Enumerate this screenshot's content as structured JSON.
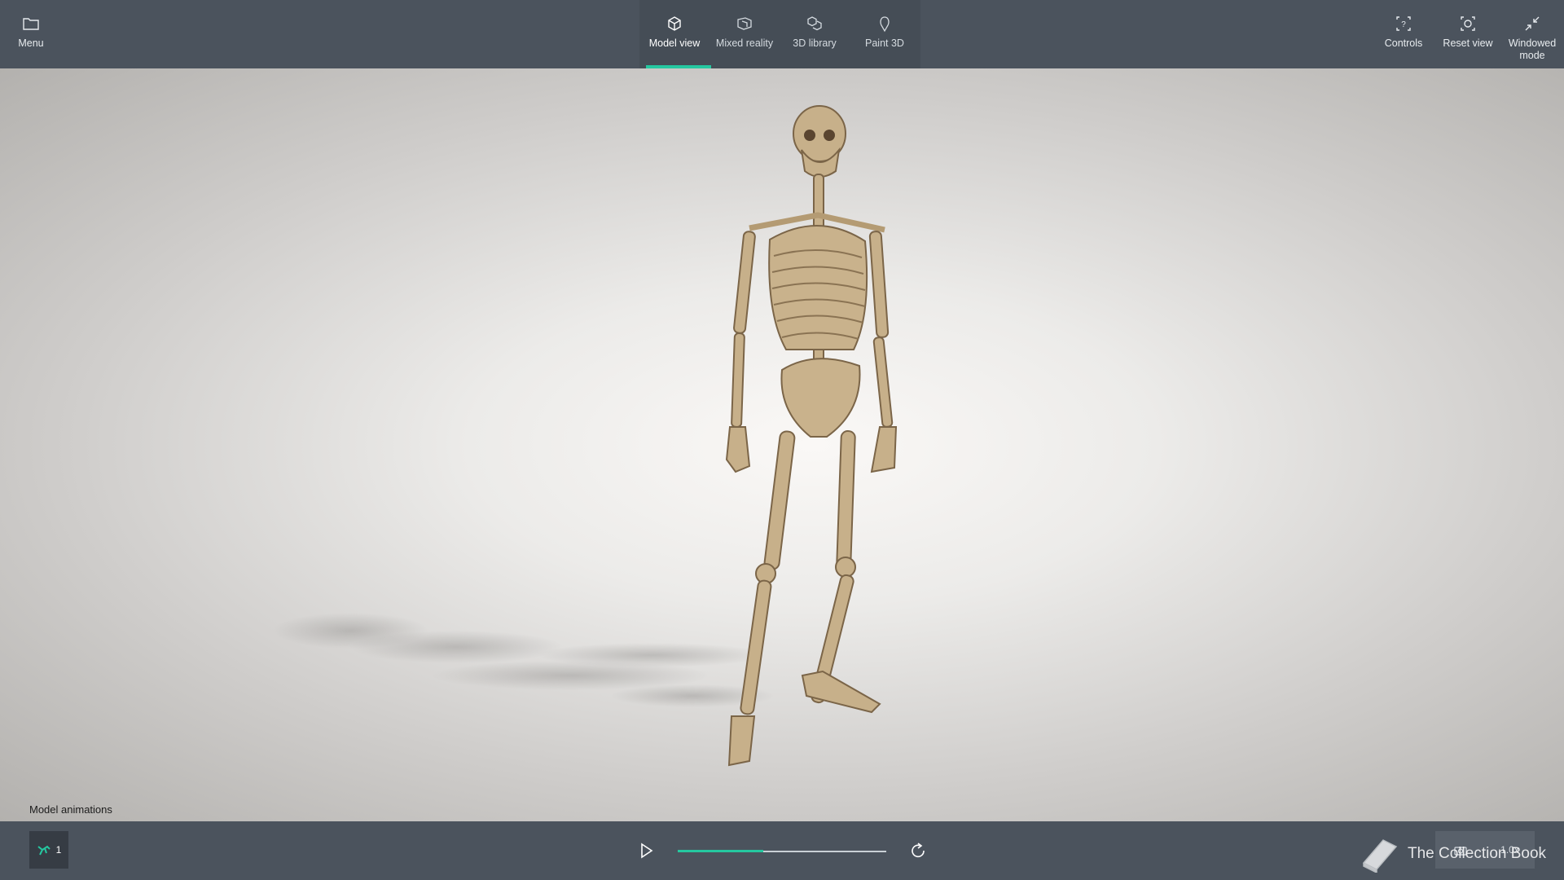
{
  "topbar": {
    "menu_label": "Menu",
    "tabs": [
      {
        "label": "Model view",
        "icon": "cube-icon",
        "active": true
      },
      {
        "label": "Mixed reality",
        "icon": "mixed-reality-icon",
        "active": false
      },
      {
        "label": "3D library",
        "icon": "3d-library-icon",
        "active": false
      },
      {
        "label": "Paint 3D",
        "icon": "paint-3d-icon",
        "active": false
      }
    ],
    "right": [
      {
        "label": "Controls",
        "icon": "controls-icon"
      },
      {
        "label": "Reset view",
        "icon": "reset-view-icon"
      },
      {
        "label": "Windowed\nmode",
        "icon": "windowed-mode-icon"
      }
    ]
  },
  "viewport": {
    "model": "skeleton-model"
  },
  "animations": {
    "section_label": "Model animations",
    "chip_count": "1",
    "progress": 0.41,
    "speed": "1.0x"
  },
  "watermark": "The Collection Book",
  "colors": {
    "accent": "#25c8a0",
    "bar": "#4b535d"
  }
}
